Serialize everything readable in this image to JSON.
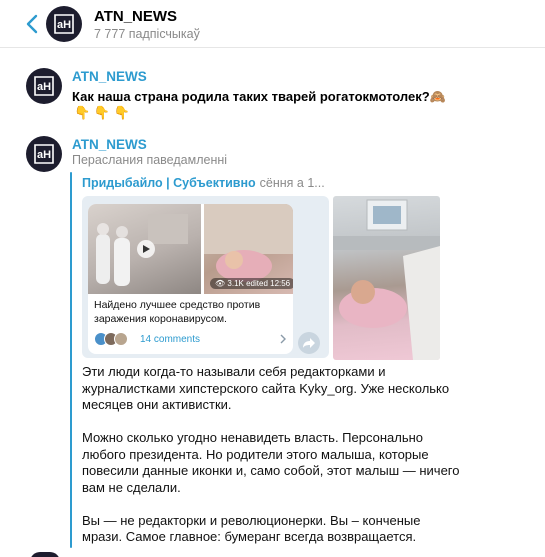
{
  "header": {
    "title": "ATN_NEWS",
    "subscribers": "7 777 падпісчыкаў"
  },
  "channel": {
    "avatar_text": "aH"
  },
  "message1": {
    "author": "ATN_NEWS",
    "text": "Как наша страна родила таких тварей рогатокмотолек?🙈",
    "emojis": "👇 👇 👇"
  },
  "message2": {
    "author": "ATN_NEWS",
    "forwarded_label": "Пераслания паведамленні",
    "source": "Придыбайло | Субъективно",
    "time": "сёння а 1...",
    "card": {
      "caption": "Найдено лучшее средство против заражения коронавирусом.",
      "views": "3.1K",
      "edited": "edited 12:56",
      "comments": "14 comments"
    },
    "paragraphs": [
      "Эти люди когда-то называли себя редакторками и журналистками хипстерского сайта Kyky_org. Уже несколько месяцев они активистки.",
      "Можно сколько угодно ненавидеть власть. Персонально любого президента. Но родители этого малыша, которые повесили данные иконки и, само собой, этот малыш — ничего вам не сделали.",
      "Вы — не редакторки и революционерки. Вы – конченые мрази. Самое главное: бумеранг всегда возвращается."
    ]
  },
  "colors": {
    "accent": "#2d9bcf",
    "avatar_bg": "#1d1d2e"
  },
  "icons": [
    "back-chevron-icon",
    "channel-logo-icon",
    "play-icon",
    "eye-icon",
    "chevron-right-icon",
    "share-icon"
  ]
}
